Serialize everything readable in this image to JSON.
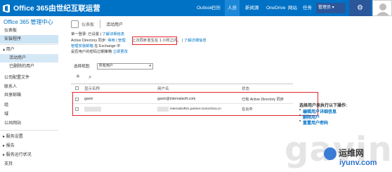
{
  "topbar": {
    "brand": "Office 365由世纪互联运营",
    "nav": [
      "Outlook",
      "日历",
      "人员",
      "新闻源",
      "OneDrive",
      "网站",
      "任务"
    ],
    "active_nav": "人员",
    "user_menu": "管理员 ▾",
    "admin_icon": "gear-icon",
    "colors": {
      "bar": "#0072c6",
      "active": "#1e88d8",
      "highlight_box": "#e0262d"
    }
  },
  "sidebar": {
    "title": "Office 365 管理中心",
    "items": [
      "仪表板",
      "安装程序",
      "▴ 用户",
      "活动用户",
      "已删除的用户",
      "公司配置文件",
      "联系人",
      "共享邮箱",
      "组",
      "域",
      "公共网站",
      "▸ 服务设置",
      "▸ 报告",
      "▸ 服务运行状况",
      "支持"
    ]
  },
  "page_header": {
    "crumb": "仪表板",
    "title": "活动用户"
  },
  "info": {
    "line1_label": "单一登录:",
    "line1_status": "已设置",
    "line1_link": "了解详细信息",
    "line2_label": "Active Directory 同步:",
    "line2_status1": "停用",
    "line2_status2": "管理",
    "line2_boxed": "上次同步发生在 1 小时之内。",
    "line2_link": "了解详细信息",
    "line3": "管理安装邮箱",
    "line3b": "在 Exchange 中",
    "line4": "是否用户的密码过期策略",
    "line4_link": "立即更改"
  },
  "filter": {
    "label": "选择视图:",
    "value": "所有用户"
  },
  "toolbar": {
    "add": "+",
    "search": "🔍"
  },
  "table": {
    "columns": [
      "显示名称",
      "用户名",
      "状态"
    ],
    "rows": [
      {
        "name": "gavin",
        "user": "gavin@internalsoft.com",
        "status": "已有 Active Directory 同步"
      },
      {
        "name": "",
        "user": "internalsoft01.partner.onmschina.cn",
        "status": "在云中"
      }
    ]
  },
  "detail": {
    "title": "选择用户来执行以下操作:",
    "actions": [
      "编辑用户详细信息",
      "删除用户",
      "重置用户密码"
    ]
  },
  "watermark": "gavin",
  "logo": {
    "main": "运维网",
    "url": "iyunv.com"
  }
}
